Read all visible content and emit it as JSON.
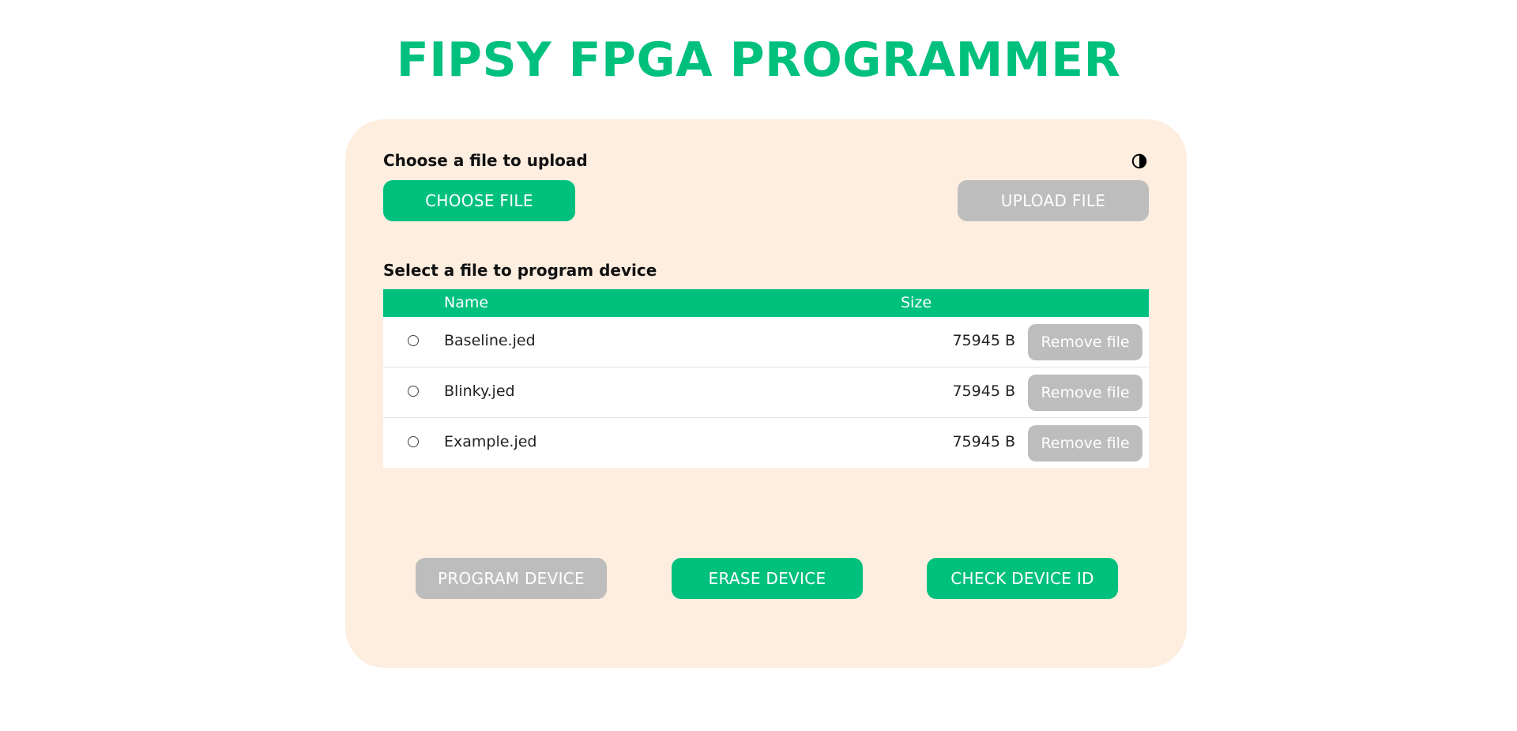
{
  "header": {
    "title": "FIPSY FPGA PROGRAMMER"
  },
  "upload_section": {
    "label": "Choose a file to upload",
    "choose_button": "CHOOSE FILE",
    "upload_button": "UPLOAD FILE",
    "theme_toggle_icon": "contrast-icon"
  },
  "program_section": {
    "label": "Select a file to program device",
    "columns": [
      "Name",
      "Size"
    ],
    "files": [
      {
        "name": "Baseline.jed",
        "size": "75945 B",
        "remove_label": "Remove file"
      },
      {
        "name": "Blinky.jed",
        "size": "75945 B",
        "remove_label": "Remove file"
      },
      {
        "name": "Example.jed",
        "size": "75945 B",
        "remove_label": "Remove file"
      }
    ]
  },
  "actions": {
    "program_device": "PROGRAM DEVICE",
    "erase_device": "ERASE DEVICE",
    "check_device_id": "CHECK DEVICE ID"
  },
  "colors": {
    "accent": "#00c07e",
    "panel_background": "#fdeee0",
    "disabled": "#bdbdbd"
  }
}
